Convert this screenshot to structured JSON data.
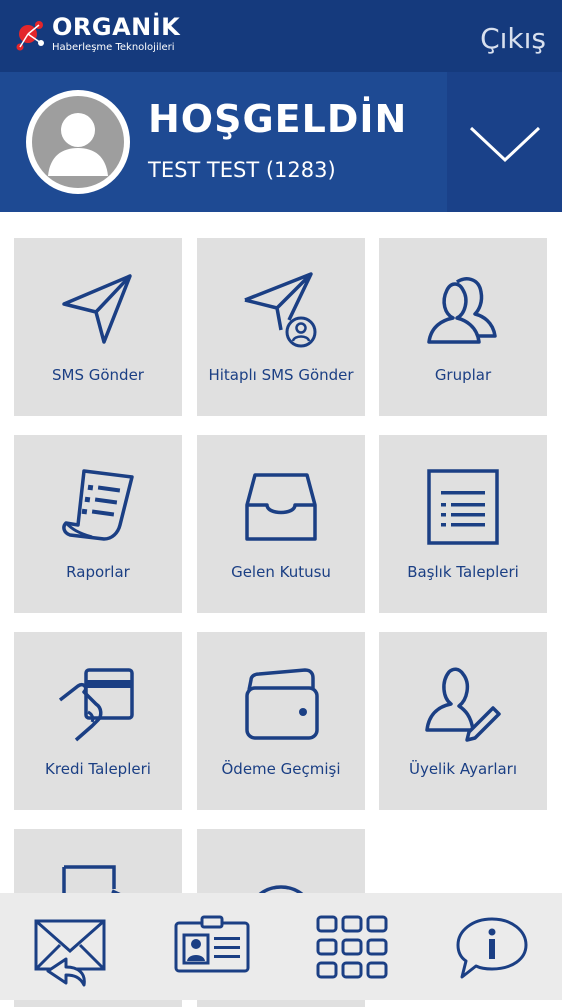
{
  "header": {
    "logo_name": "ORGANİK",
    "logo_tagline": "Haberleşme Teknolojileri",
    "logout_label": "Çıkış"
  },
  "welcome": {
    "title": "HOŞGELDİN",
    "user": "TEST TEST (1283)"
  },
  "menu": {
    "items": [
      {
        "label": "SMS Gönder",
        "icon": "paper-plane-icon"
      },
      {
        "label": "Hitaplı SMS Gönder",
        "icon": "paper-plane-user-icon"
      },
      {
        "label": "Gruplar",
        "icon": "users-icon"
      },
      {
        "label": "Raporlar",
        "icon": "report-document-icon"
      },
      {
        "label": "Gelen Kutusu",
        "icon": "inbox-tray-icon"
      },
      {
        "label": "Başlık Talepleri",
        "icon": "list-document-icon"
      },
      {
        "label": "Kredi Talepleri",
        "icon": "hand-card-icon"
      },
      {
        "label": "Ödeme Geçmişi",
        "icon": "wallet-icon"
      },
      {
        "label": "Üyelik Ayarları",
        "icon": "user-edit-icon"
      },
      {
        "label": "",
        "icon": "logout-document-icon"
      },
      {
        "label": "",
        "icon": "close-circle-icon"
      }
    ]
  },
  "bottom_nav": {
    "items": [
      {
        "icon": "mail-reply-icon"
      },
      {
        "icon": "contact-card-icon"
      },
      {
        "icon": "grid-menu-icon"
      },
      {
        "icon": "info-bubble-icon"
      }
    ]
  },
  "colors": {
    "primary": "#153a7d",
    "welcome_bg": "#1e4a93",
    "tile_bg": "#e0e0e0",
    "icon": "#1b3f84",
    "logo_accent": "#e3262b"
  }
}
